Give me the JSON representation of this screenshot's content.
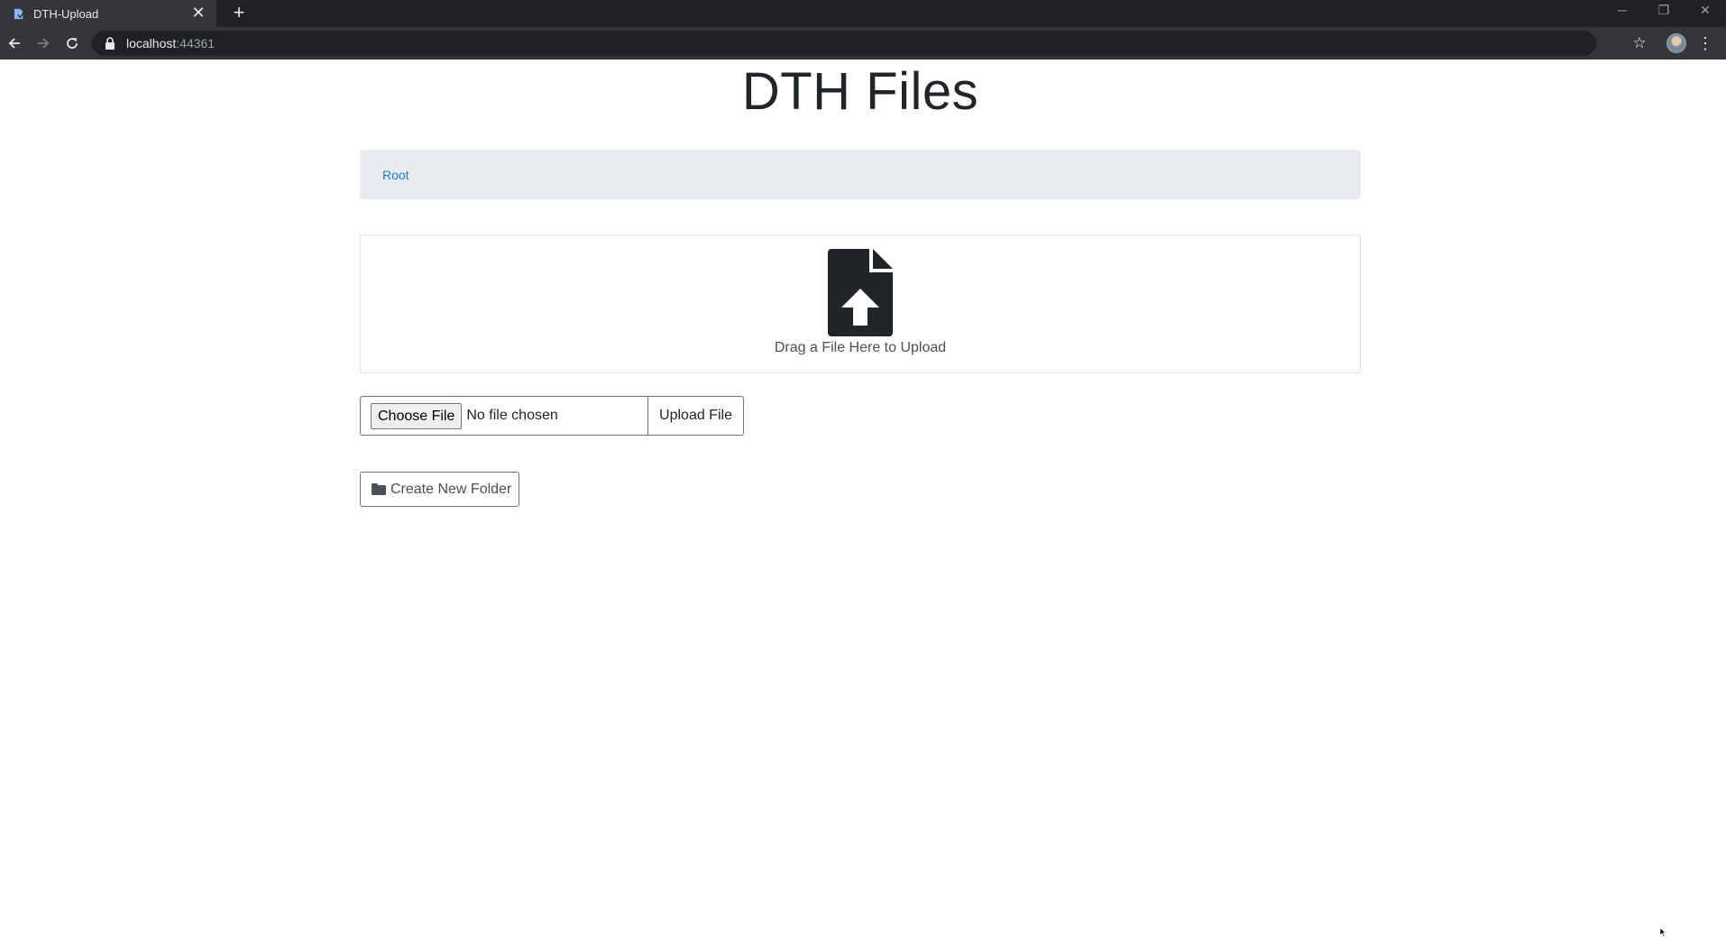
{
  "browser": {
    "tab_title": "DTH-Upload",
    "new_tab_symbol": "+",
    "close_symbol": "✕",
    "url_host": "localhost",
    "url_port": ":44361",
    "window_controls": {
      "minimize": "─",
      "restore": "❐",
      "close": "✕"
    }
  },
  "page": {
    "title": "DTH Files",
    "breadcrumb": {
      "root_label": "Root"
    },
    "dropzone": {
      "text": "Drag a File Here to Upload",
      "icon": "file-upload-icon"
    },
    "file_input": {
      "button_label": "Choose File",
      "status_text": "No file chosen"
    },
    "upload_button_label": "Upload File",
    "new_folder_button_label": "Create New Folder",
    "colors": {
      "link": "#1f7ae0",
      "breadcrumb_bg": "#e9ecef",
      "icon": "#212529"
    }
  }
}
